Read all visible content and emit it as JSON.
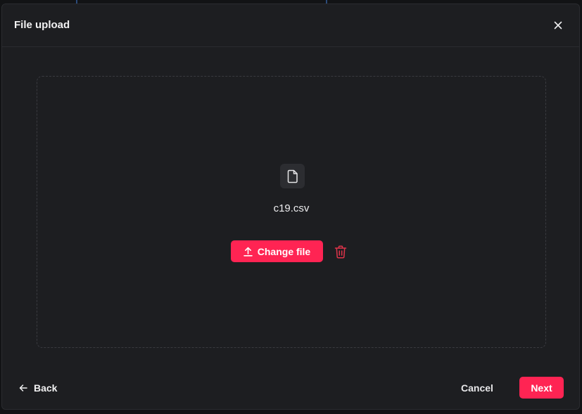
{
  "dialog": {
    "title": "File upload",
    "close_icon": "close-icon"
  },
  "dropzone": {
    "file_icon": "file-icon",
    "file_name": "c19.csv",
    "change_file_label": "Change file",
    "upload_icon": "upload-icon",
    "delete_icon": "trash-icon"
  },
  "footer": {
    "back_label": "Back",
    "back_icon": "arrow-left-icon",
    "cancel_label": "Cancel",
    "next_label": "Next"
  },
  "colors": {
    "accent": "#ff2453",
    "delete": "#e0344a",
    "dialog_bg": "#1d1e21",
    "text": "#f2f2f3"
  }
}
